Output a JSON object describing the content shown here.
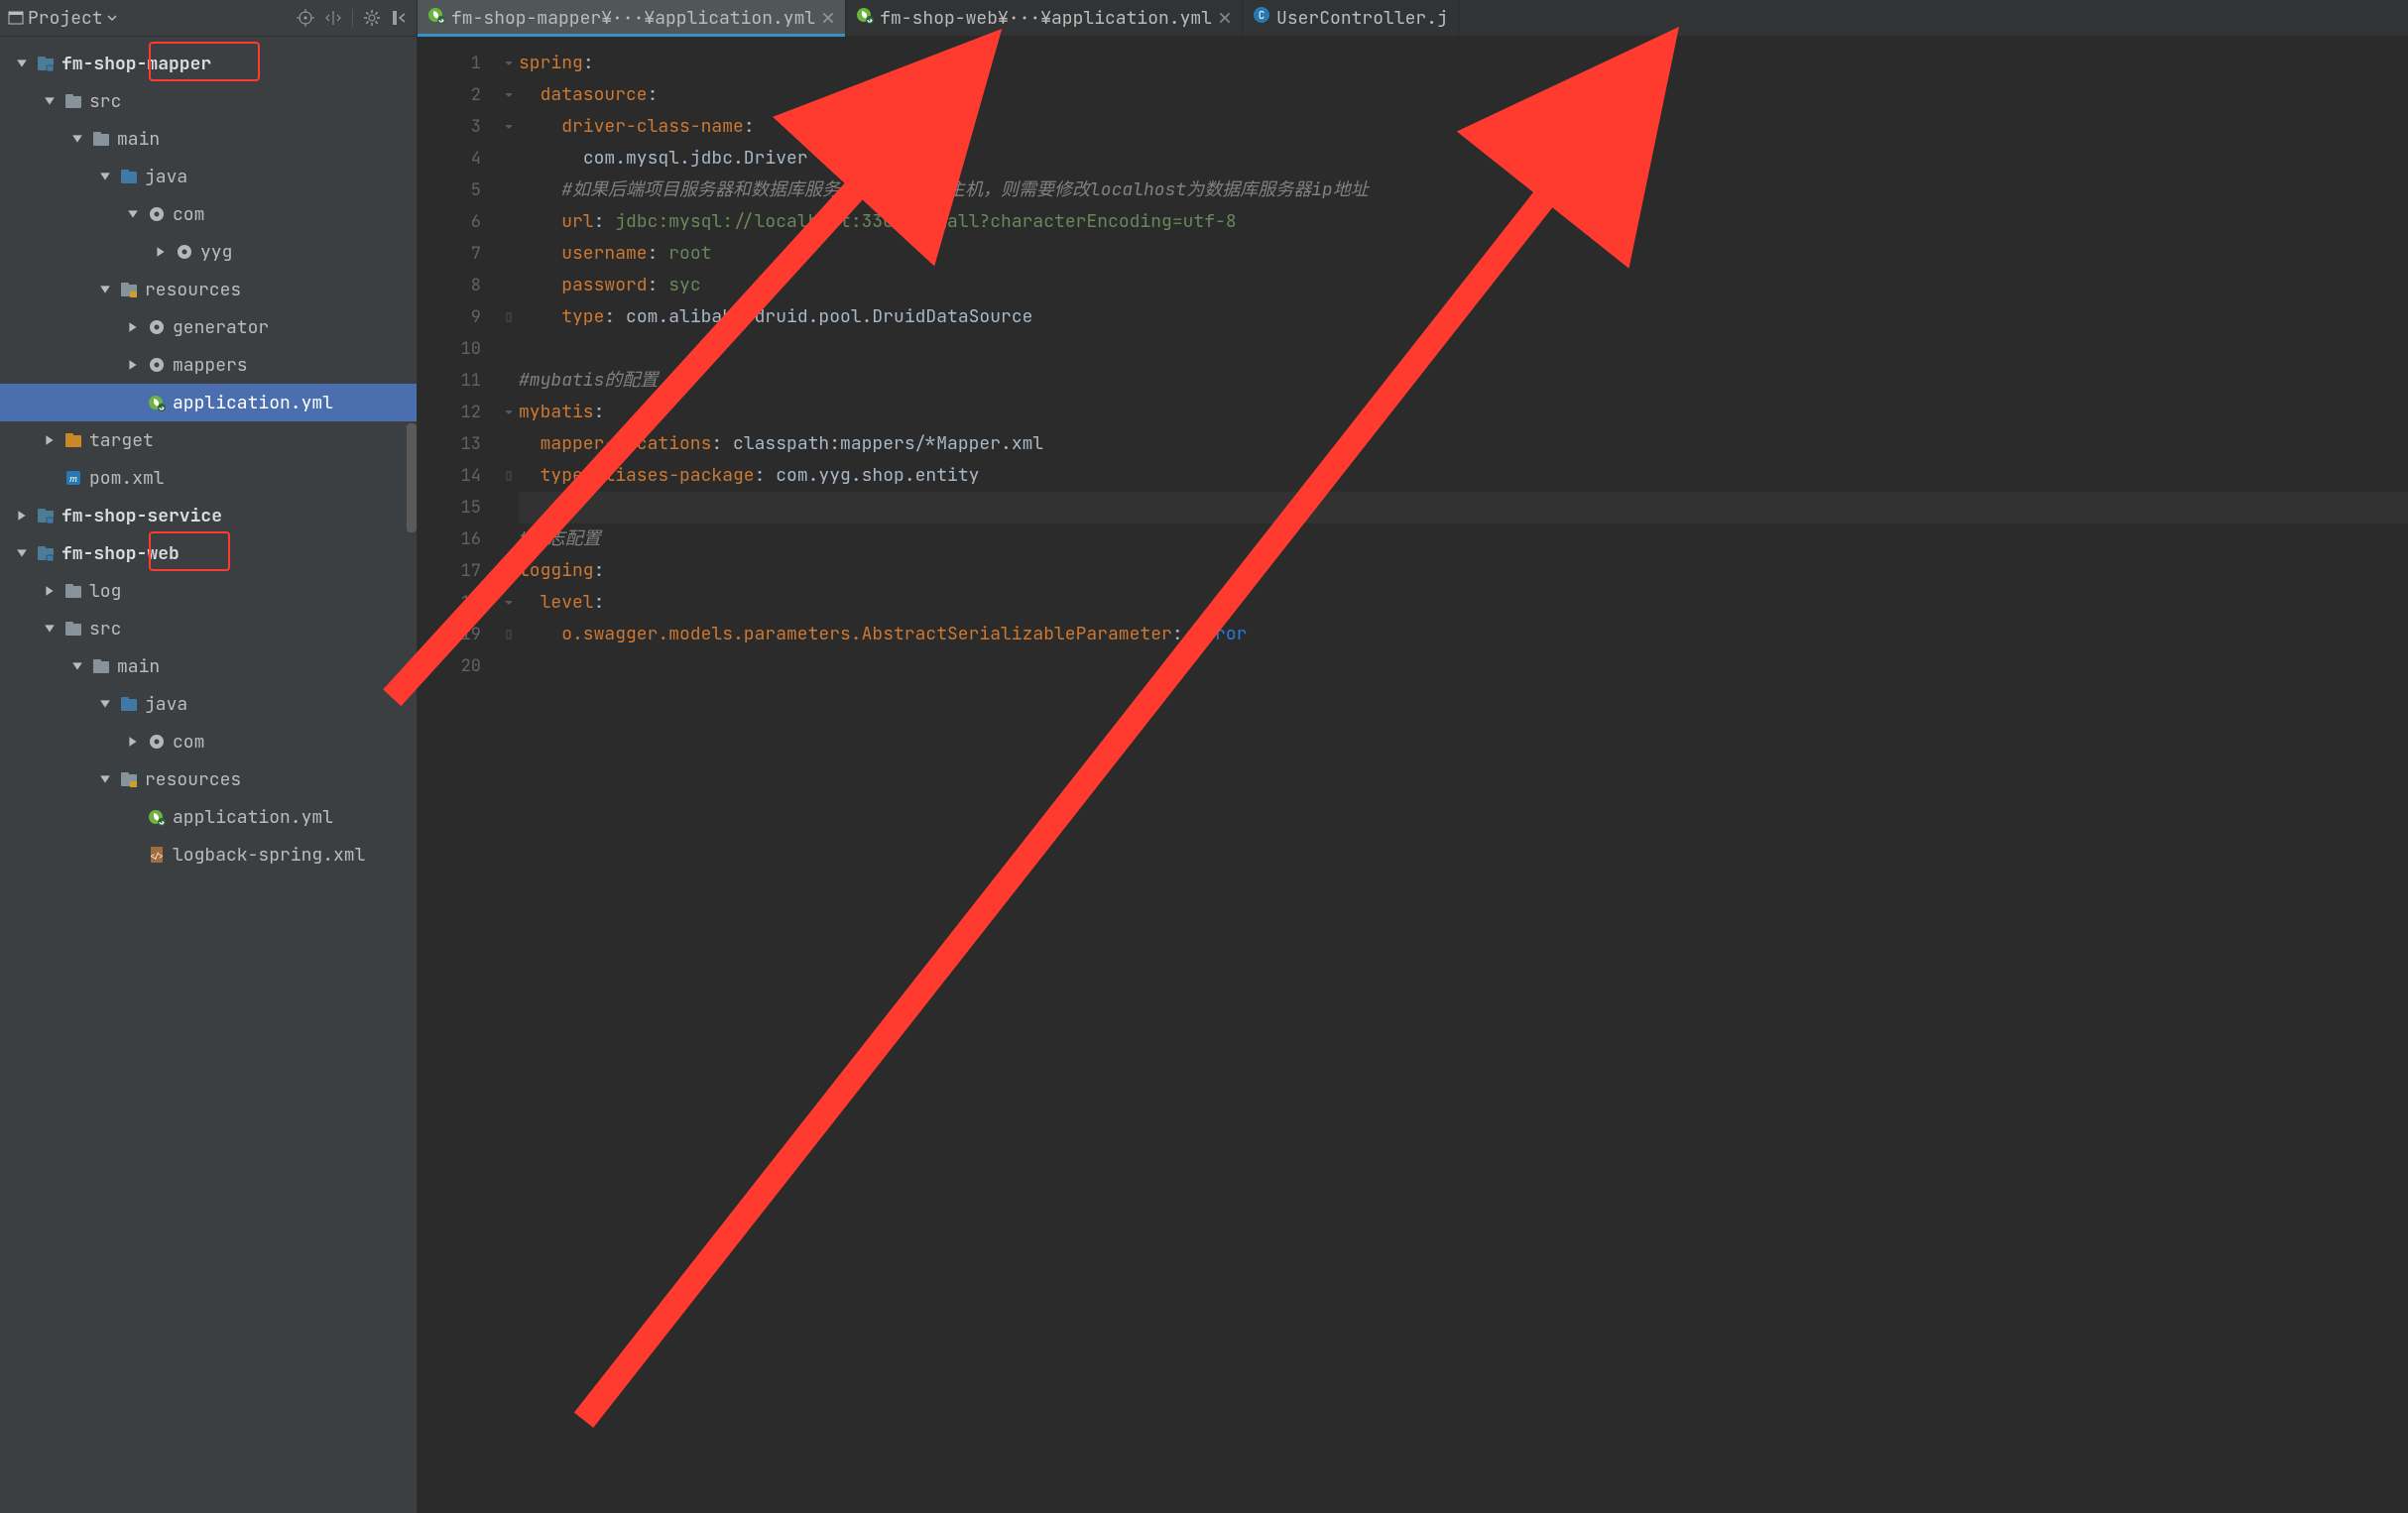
{
  "colors": {
    "annotation_red": "#ff3b30"
  },
  "sidebar": {
    "title": "Project",
    "toolbar_icons": [
      "target-icon",
      "split-icon",
      "gear-icon",
      "collapse-icon"
    ]
  },
  "tree": [
    {
      "d": 0,
      "tw": "open",
      "ic": "module",
      "lbl": "fm-shop-mapper",
      "bold": true,
      "hl": [
        150,
        258
      ]
    },
    {
      "d": 1,
      "tw": "open",
      "ic": "folder",
      "lbl": "src"
    },
    {
      "d": 2,
      "tw": "open",
      "ic": "folder",
      "lbl": "main"
    },
    {
      "d": 3,
      "tw": "open",
      "ic": "folder-src",
      "lbl": "java"
    },
    {
      "d": 4,
      "tw": "open",
      "ic": "pkg",
      "lbl": "com"
    },
    {
      "d": 5,
      "tw": "closed",
      "ic": "pkg",
      "lbl": "yyg"
    },
    {
      "d": 3,
      "tw": "open",
      "ic": "folder-res",
      "lbl": "resources"
    },
    {
      "d": 4,
      "tw": "closed",
      "ic": "pkg",
      "lbl": "generator"
    },
    {
      "d": 4,
      "tw": "closed",
      "ic": "pkg",
      "lbl": "mappers"
    },
    {
      "d": 4,
      "tw": "none",
      "ic": "spring",
      "lbl": "application.yml",
      "sel": true
    },
    {
      "d": 1,
      "tw": "closed",
      "ic": "folder-exc",
      "lbl": "target"
    },
    {
      "d": 1,
      "tw": "none",
      "ic": "maven",
      "lbl": "pom.xml"
    },
    {
      "d": 0,
      "tw": "closed",
      "ic": "module",
      "lbl": "fm-shop-service",
      "bold": true
    },
    {
      "d": 0,
      "tw": "open",
      "ic": "module",
      "lbl": "fm-shop-web",
      "bold": true,
      "hl": [
        150,
        228
      ]
    },
    {
      "d": 1,
      "tw": "closed",
      "ic": "folder",
      "lbl": "log"
    },
    {
      "d": 1,
      "tw": "open",
      "ic": "folder",
      "lbl": "src"
    },
    {
      "d": 2,
      "tw": "open",
      "ic": "folder",
      "lbl": "main"
    },
    {
      "d": 3,
      "tw": "open",
      "ic": "folder-src",
      "lbl": "java"
    },
    {
      "d": 4,
      "tw": "closed",
      "ic": "pkg",
      "lbl": "com"
    },
    {
      "d": 3,
      "tw": "open",
      "ic": "folder-res",
      "lbl": "resources"
    },
    {
      "d": 4,
      "tw": "none",
      "ic": "spring",
      "lbl": "application.yml"
    },
    {
      "d": 4,
      "tw": "none",
      "ic": "xml",
      "lbl": "logback-spring.xml"
    }
  ],
  "tabs": [
    {
      "icon": "spring",
      "label": "fm-shop-mapper¥···¥application.yml",
      "close": true,
      "active": true
    },
    {
      "icon": "spring",
      "label": "fm-shop-web¥···¥application.yml",
      "close": true,
      "active": false
    },
    {
      "icon": "class",
      "label": "UserController.j",
      "close": false,
      "active": false
    }
  ],
  "code": [
    {
      "n": 1,
      "fold": "open",
      "html": "<span class='key'>spring</span><span class='idn'>:</span>"
    },
    {
      "n": 2,
      "fold": "open",
      "html": "  <span class='key'>datasource</span><span class='idn'>:</span>"
    },
    {
      "n": 3,
      "fold": "open",
      "html": "    <span class='key'>driver-class-name</span><span class='idn'>:</span>"
    },
    {
      "n": 4,
      "fold": "",
      "html": "      <span class='idn'>com.mysql.jdbc.Driver</span>"
    },
    {
      "n": 5,
      "fold": "",
      "html": "    <span class='cmt'>#如果后端项目服务器和数据库服务器不在同一台主机，则需要修改localhost为数据库服务器ip地址</span>"
    },
    {
      "n": 6,
      "fold": "",
      "html": "    <span class='key'>url</span><span class='idn'>: </span><span class='str'>jdbc:mysql://localhost:3306/fmmall?characterEncoding=utf-8</span>"
    },
    {
      "n": 7,
      "fold": "",
      "html": "    <span class='key'>username</span><span class='idn'>: </span><span class='str'>root</span>"
    },
    {
      "n": 8,
      "fold": "",
      "html": "    <span class='key'>password</span><span class='idn'>: </span><span class='str'>syc</span>"
    },
    {
      "n": 9,
      "fold": "end",
      "html": "    <span class='key'>type</span><span class='idn'>: </span><span class='idn'>com.alibaba.druid.pool.DruidDataSource</span>"
    },
    {
      "n": 10,
      "fold": "",
      "html": ""
    },
    {
      "n": 11,
      "fold": "",
      "html": "<span class='cmt'>#mybatis的配置</span>"
    },
    {
      "n": 12,
      "fold": "open",
      "html": "<span class='key'>mybatis</span><span class='idn'>:</span>"
    },
    {
      "n": 13,
      "fold": "",
      "html": "  <span class='key'>mapper-locations</span><span class='idn'>: </span><span class='idn'>classpath:mappers/*Mapper.xml</span>"
    },
    {
      "n": 14,
      "fold": "end",
      "html": "  <span class='key'>type-aliases-package</span><span class='idn'>: </span><span class='idn'>com.yyg.shop.entity</span>"
    },
    {
      "n": 15,
      "fold": "",
      "html": "",
      "cur": true
    },
    {
      "n": 16,
      "fold": "",
      "html": "<span class='cmt'>#日志配置</span>"
    },
    {
      "n": 17,
      "fold": "open",
      "html": "<span class='key'>logging</span><span class='idn'>:</span>"
    },
    {
      "n": 18,
      "fold": "open",
      "html": "  <span class='key'>level</span><span class='idn'>:</span>"
    },
    {
      "n": 19,
      "fold": "end",
      "html": "    <span class='key'>o.swagger.models.parameters.AbstractSerializableParameter</span><span class='idn'>: </span><span class='blu'>error</span>"
    },
    {
      "n": 20,
      "fold": "",
      "html": ""
    }
  ]
}
